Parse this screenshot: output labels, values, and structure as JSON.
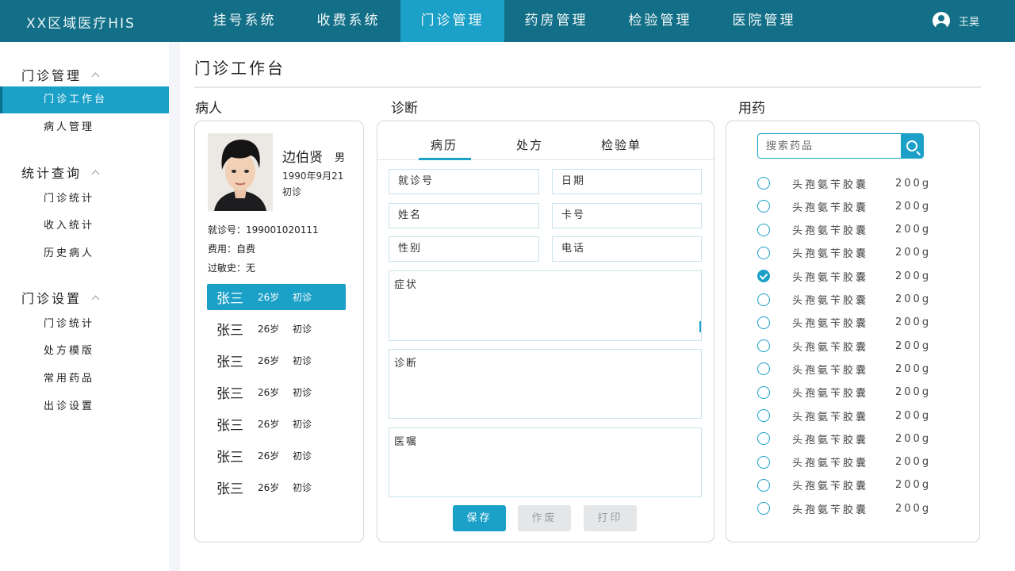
{
  "header": {
    "brand": "XX区域医疗HIS",
    "nav": [
      "挂号系统",
      "收费系统",
      "门诊管理",
      "药房管理",
      "检验管理",
      "医院管理"
    ],
    "active_nav": "门诊管理",
    "user_name": "王昊"
  },
  "sidebar": {
    "groups": [
      {
        "label": "门诊管理",
        "items": [
          "门诊工作台",
          "病人管理"
        ]
      },
      {
        "label": "统计查询",
        "items": [
          "门诊统计",
          "收入统计",
          "历史病人"
        ]
      },
      {
        "label": "门诊设置",
        "items": [
          "门诊统计",
          "处方模版",
          "常用药品",
          "出诊设置"
        ]
      }
    ],
    "active_item": "门诊工作台"
  },
  "page": {
    "title": "门诊工作台",
    "sections": {
      "patient": "病人",
      "diagnosis": "诊断",
      "medication": "用药"
    }
  },
  "patient": {
    "name": "边伯贤",
    "sex": "男",
    "dob": "1990年9月21",
    "visit_type": "初诊",
    "visit_no": "就诊号：199001020111",
    "payment": "费用：自费",
    "allergy": "过敏史：无",
    "queue": [
      {
        "name": "张三",
        "age": "26岁",
        "type": "初诊",
        "active": true
      },
      {
        "name": "张三",
        "age": "26岁",
        "type": "初诊"
      },
      {
        "name": "张三",
        "age": "26岁",
        "type": "初诊"
      },
      {
        "name": "张三",
        "age": "26岁",
        "type": "初诊"
      },
      {
        "name": "张三",
        "age": "26岁",
        "type": "初诊"
      },
      {
        "name": "张三",
        "age": "26岁",
        "type": "初诊"
      },
      {
        "name": "张三",
        "age": "26岁",
        "type": "初诊"
      }
    ]
  },
  "diagnosis": {
    "tabs": [
      "病历",
      "处方",
      "检验单"
    ],
    "active_tab": "病历",
    "fields": {
      "visit_no": "就诊号",
      "date": "日期",
      "name": "姓名",
      "card_no": "卡号",
      "sex": "性别",
      "phone": "电话"
    },
    "symptom_label": "症状",
    "diagnosis_label": "诊断",
    "advice_label": "医嘱",
    "buttons": {
      "save": "保存",
      "void": "作废",
      "print": "打印"
    }
  },
  "medication": {
    "search_placeholder": "搜索药品",
    "drugs": [
      {
        "name": "头孢氨苄胶囊",
        "qty": "200g",
        "checked": false
      },
      {
        "name": "头孢氨苄胶囊",
        "qty": "200g",
        "checked": false
      },
      {
        "name": "头孢氨苄胶囊",
        "qty": "200g",
        "checked": false
      },
      {
        "name": "头孢氨苄胶囊",
        "qty": "200g",
        "checked": false
      },
      {
        "name": "头孢氨苄胶囊",
        "qty": "200g",
        "checked": true
      },
      {
        "name": "头孢氨苄胶囊",
        "qty": "200g",
        "checked": false
      },
      {
        "name": "头孢氨苄胶囊",
        "qty": "200g",
        "checked": false
      },
      {
        "name": "头孢氨苄胶囊",
        "qty": "200g",
        "checked": false
      },
      {
        "name": "头孢氨苄胶囊",
        "qty": "200g",
        "checked": false
      },
      {
        "name": "头孢氨苄胶囊",
        "qty": "200g",
        "checked": false
      },
      {
        "name": "头孢氨苄胶囊",
        "qty": "200g",
        "checked": false
      },
      {
        "name": "头孢氨苄胶囊",
        "qty": "200g",
        "checked": false
      },
      {
        "name": "头孢氨苄胶囊",
        "qty": "200g",
        "checked": false
      },
      {
        "name": "头孢氨苄胶囊",
        "qty": "200g",
        "checked": false
      },
      {
        "name": "头孢氨苄胶囊",
        "qty": "200g",
        "checked": false
      }
    ]
  },
  "colors": {
    "topbar": "#126f87",
    "accent": "#1ba0c8",
    "disabled": "#e4e6e8"
  }
}
